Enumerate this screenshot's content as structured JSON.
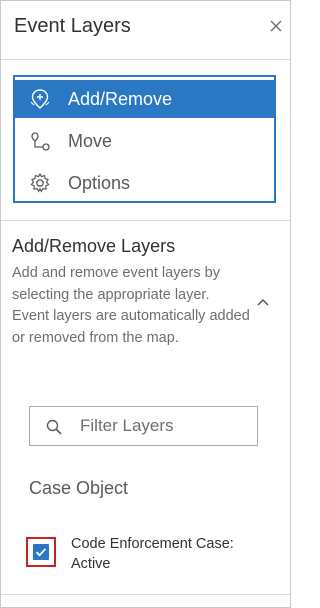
{
  "panel": {
    "title": "Event Layers",
    "close_icon": "close-icon"
  },
  "menu": {
    "items": [
      {
        "label": "Add/Remove",
        "icon": "add-remove-icon",
        "active": true
      },
      {
        "label": "Move",
        "icon": "move-icon",
        "active": false
      },
      {
        "label": "Options",
        "icon": "gear-icon",
        "active": false
      }
    ],
    "accent_color": "#2a78c3"
  },
  "section": {
    "title": "Add/Remove Layers",
    "description": "Add and remove event layers by selecting the appropriate layer. Event layers are automatically added or removed from the map.",
    "collapse_icon": "chevron-up-icon"
  },
  "filter": {
    "placeholder": "Filter Layers",
    "value": "",
    "icon": "search-icon"
  },
  "group": {
    "title": "Case Object",
    "layers": [
      {
        "label": "Code Enforcement Case: Active",
        "checked": true
      }
    ]
  }
}
